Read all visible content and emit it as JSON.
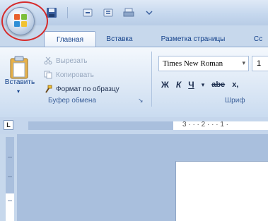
{
  "window": {
    "quick_access": {
      "save_icon": "floppy-disk-icon",
      "undo_icon": "undo-icon",
      "redo_icon": "redo-icon",
      "print_icon": "print-icon",
      "dropdown_icon": "chevron-down-icon"
    },
    "office_button_icon": "office-logo-icon"
  },
  "tabs": [
    {
      "label": "Главная",
      "active": true
    },
    {
      "label": "Вставка",
      "active": false
    },
    {
      "label": "Разметка страницы",
      "active": false
    },
    {
      "label": "Сс",
      "active": false
    }
  ],
  "ribbon": {
    "clipboard": {
      "paste_label": "Вставить",
      "cut_label": "Вырезать",
      "copy_label": "Копировать",
      "format_painter_label": "Формат по образцу",
      "group_label": "Буфер обмена"
    },
    "font": {
      "font_name": "Times New Roman",
      "font_size": "1",
      "bold_label": "Ж",
      "italic_label": "К",
      "underline_label": "Ч",
      "strike_label": "abe",
      "subscript_label": "x,",
      "group_label": "Шриф"
    }
  },
  "ruler": {
    "corner_label": "L",
    "numbers": "3 · · · 2 · · · 1 ·"
  },
  "colors": {
    "highlight": "#d62b2b",
    "ribbon_text": "#15428b"
  }
}
